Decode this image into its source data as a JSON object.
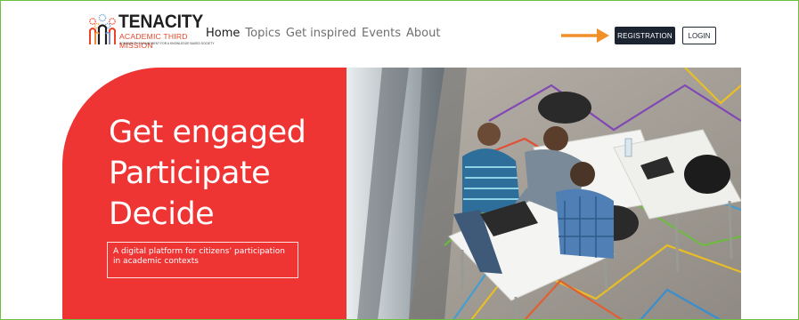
{
  "brand": {
    "name": "TENACITY",
    "subtitle": "ACADEMIC THIRD MISSION",
    "tagline": "COMMUNITY ENGAGEMENT FOR A KNOWLEDGE BASED SOCIETY",
    "accent": "#e8462b"
  },
  "nav": {
    "items": [
      {
        "label": "Home",
        "active": true
      },
      {
        "label": "Topics",
        "active": false
      },
      {
        "label": "Get inspired",
        "active": false
      },
      {
        "label": "Events",
        "active": false
      },
      {
        "label": "About",
        "active": false
      }
    ]
  },
  "header": {
    "registration_label": "REGISTRATION",
    "login_label": "LOGIN",
    "arrow_icon": "arrow-right-icon",
    "arrow_color": "#f0902a"
  },
  "hero": {
    "lines": [
      "Get engaged",
      "Participate",
      "Decide"
    ],
    "tagline": "A digital platform for citizens’ participation in academic contexts",
    "red": "#ef3434",
    "image_description_icon": "people-working-photo"
  },
  "colors": {
    "button_dark": "#1c2431",
    "frame_green": "#6dbf3f"
  }
}
